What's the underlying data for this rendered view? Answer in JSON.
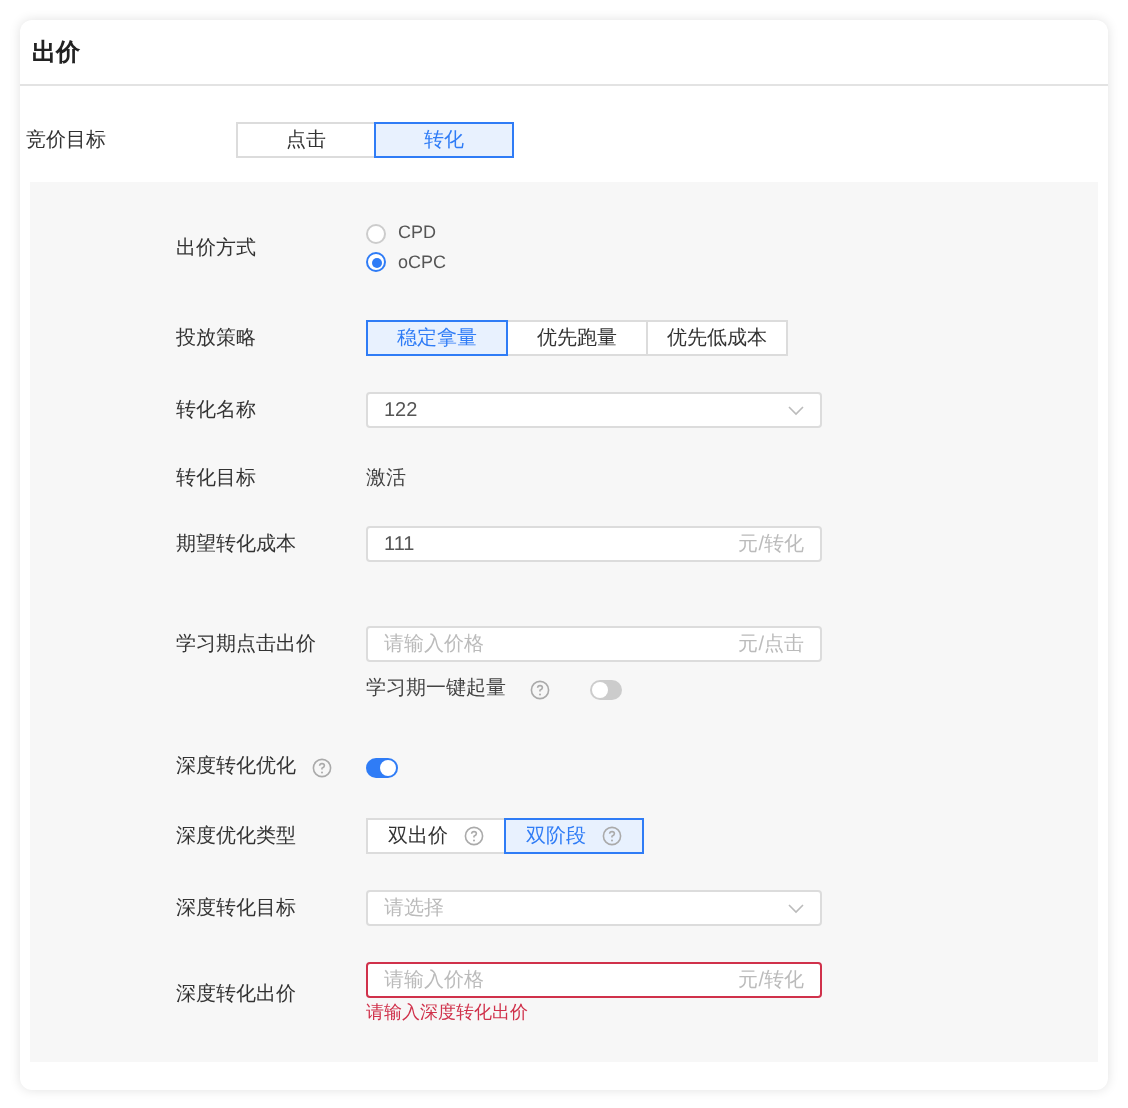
{
  "card": {
    "title": "出价"
  },
  "bid_target": {
    "label": "竞价目标",
    "options": [
      {
        "label": "点击",
        "selected": false
      },
      {
        "label": "转化",
        "selected": true
      }
    ]
  },
  "fields": [
    {
      "kind": "radio",
      "label": "出价方式",
      "options": [
        {
          "label": "CPD",
          "selected": false
        },
        {
          "label": "oCPC",
          "selected": true
        }
      ]
    },
    {
      "kind": "segmented",
      "label": "投放策略",
      "options": [
        {
          "label": "稳定拿量",
          "selected": true,
          "help": false
        },
        {
          "label": "优先跑量",
          "selected": false,
          "help": false
        },
        {
          "label": "优先低成本",
          "selected": false,
          "help": false
        }
      ]
    },
    {
      "kind": "select",
      "label": "转化名称",
      "value": "122"
    },
    {
      "kind": "text",
      "label": "转化目标",
      "value": "激活"
    },
    {
      "kind": "input",
      "label": "期望转化成本",
      "value": "111",
      "suffix": "元/转化",
      "error": false
    },
    {
      "kind": "input",
      "label": "学习期点击出价",
      "placeholder": "请输入价格",
      "suffix": "元/点击",
      "error": false,
      "sub_switch": {
        "label": "学习期一键起量",
        "on": false
      }
    },
    {
      "kind": "switch",
      "label": "深度转化优化",
      "help": true,
      "on": true
    },
    {
      "kind": "segmented",
      "label": "深度优化类型",
      "options": [
        {
          "label": "双出价",
          "selected": false,
          "help": true
        },
        {
          "label": "双阶段",
          "selected": true,
          "help": true
        }
      ]
    },
    {
      "kind": "select",
      "label": "深度转化目标",
      "placeholder": "请选择"
    },
    {
      "kind": "input",
      "label": "深度转化出价",
      "placeholder": "请输入价格",
      "suffix": "元/转化",
      "error": true,
      "error_text": "请输入深度转化出价"
    }
  ]
}
